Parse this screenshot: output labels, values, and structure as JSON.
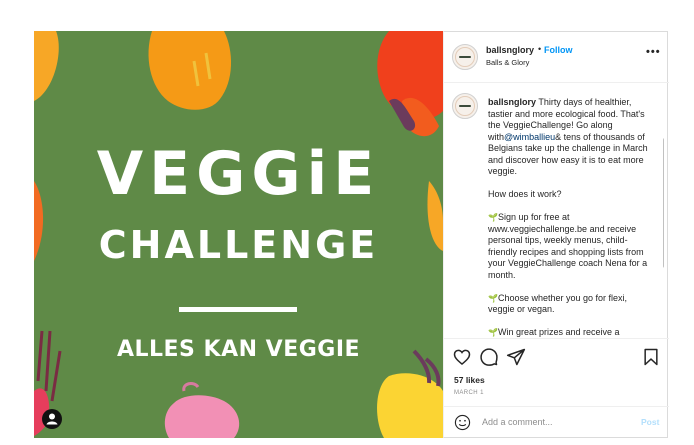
{
  "post": {
    "image": {
      "title_line1": "VEGGiE",
      "title_line2": "CHALLENGE",
      "tagline": "ALLES KAN VEGGIE",
      "tag_icon": "user-tag-icon",
      "background_color": "#5f8a47"
    },
    "header": {
      "username": "ballsnglory",
      "separator": "•",
      "follow_label": "Follow",
      "subname": "Balls & Glory",
      "more_icon": "more-horizontal-icon",
      "more_label": "•••"
    },
    "caption": {
      "username": "ballsnglory",
      "intro_a": " Thirty days of healthier, tastier and more ecological food. That's the VeggieChallenge! Go along with",
      "mention": "@wimballieu",
      "intro_b": "& tens of thousands of Belgians take up the challenge in March and discover how easy it is to eat more veggie.",
      "question": "How does it work?",
      "bullets": [
        {
          "icon": "sprout-emoji",
          "glyph": "🌱",
          "text": "Sign up for free at www.veggiechallenge.be and receive personal tips, weekly menus, child-friendly recipes and shopping lists from your VeggieChallenge coach Nena for a month."
        },
        {
          "icon": "sprout-emoji",
          "glyph": "🌱",
          "text": "Choose whether you go for flexi, veggie or vegan."
        },
        {
          "icon": "sprout-emoji",
          "glyph": "🌱",
          "text": "Win great prizes and receive a"
        }
      ]
    },
    "actions": {
      "icons": [
        "heart-icon",
        "comment-icon",
        "share-icon",
        "bookmark-icon"
      ],
      "likes": "57 likes",
      "date": "MARCH 1"
    },
    "comment_bar": {
      "emoji_icon": "emoji-icon",
      "placeholder": "Add a comment...",
      "post_label": "Post"
    }
  }
}
